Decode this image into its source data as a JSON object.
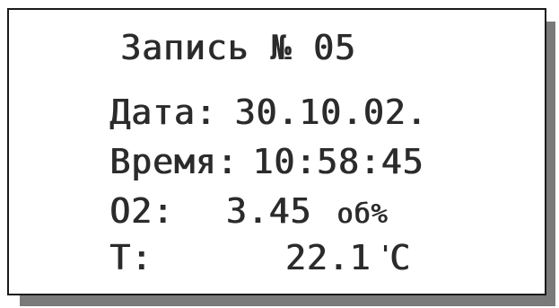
{
  "display": {
    "title": "Запись № 05",
    "date_label": "Дата:",
    "date_value": "30.10.02.",
    "time_label": "Время:",
    "time_value": "10:58:45",
    "o2_label": "O2:",
    "o2_value": "3.45",
    "o2_unit": "об%",
    "temp_label": "T:",
    "temp_value": "22.1",
    "temp_degree": "'",
    "temp_unit": "C"
  }
}
